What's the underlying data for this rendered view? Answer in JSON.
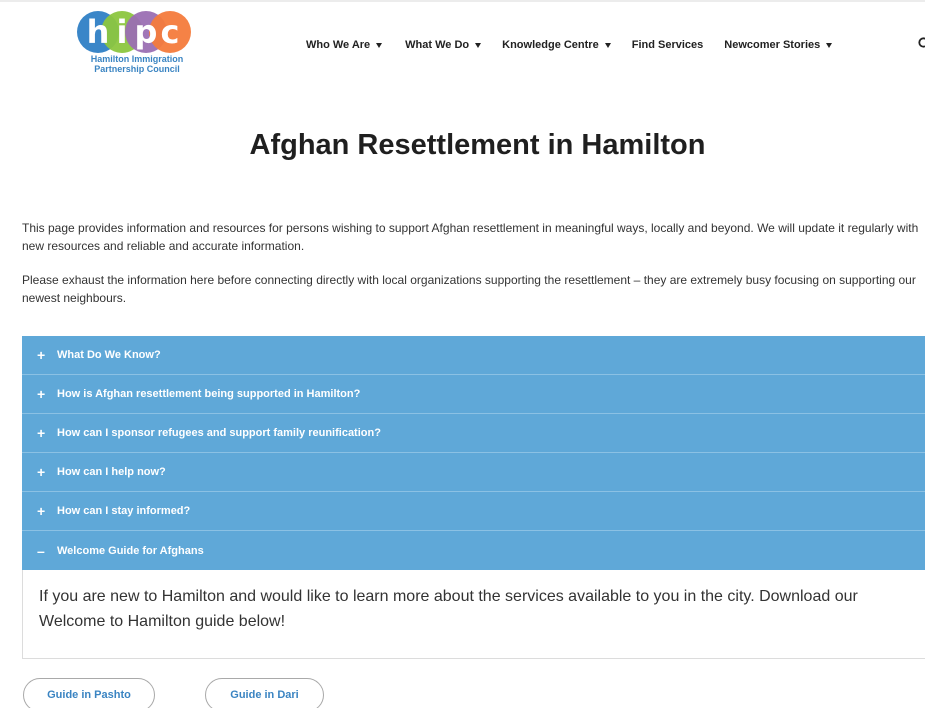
{
  "logo": {
    "letters": [
      "h",
      "i",
      "p",
      "c"
    ],
    "line1": "Hamilton Immigration",
    "line2": "Partnership Council",
    "colors": {
      "h": "#3a86c8",
      "i": "#8cc63f",
      "p": "#9b6fb3",
      "c": "#f47b3c"
    }
  },
  "nav": {
    "items": [
      {
        "label": "Who We Are",
        "dropdown": true
      },
      {
        "label": "What We Do",
        "dropdown": true
      },
      {
        "label": "Knowledge Centre",
        "dropdown": true
      },
      {
        "label": "Find Services",
        "dropdown": false
      },
      {
        "label": "Newcomer Stories",
        "dropdown": true
      }
    ],
    "search_icon": "search-icon"
  },
  "page": {
    "title": "Afghan Resettlement in Hamilton",
    "intro_1": "This page provides information and resources for persons wishing to support Afghan resettlement in meaningful ways, locally and beyond. We will update it regularly with new resources and reliable and accurate information.",
    "intro_2": "Please exhaust the information here before connecting directly with local organizations supporting the resettlement – they are extremely busy focusing on supporting our newest neighbours."
  },
  "accordion": {
    "items": [
      {
        "sign": "+",
        "label": "What Do We Know?"
      },
      {
        "sign": "+",
        "label": "How is Afghan resettlement being supported in Hamilton?"
      },
      {
        "sign": "+",
        "label": "How can I sponsor refugees and support family reunification?"
      },
      {
        "sign": "+",
        "label": "How can I help now?"
      },
      {
        "sign": "+",
        "label": "How can I stay informed?"
      },
      {
        "sign": "–",
        "label": "Welcome Guide for Afghans"
      }
    ],
    "open_panel_text": "If you are new to Hamilton and would like to learn more about the services available to you in the city. Download our Welcome to Hamilton guide below!",
    "header_color": "#5fa8d8"
  },
  "guides": {
    "pashto": "Guide in Pashto",
    "dari": "Guide in Dari"
  }
}
